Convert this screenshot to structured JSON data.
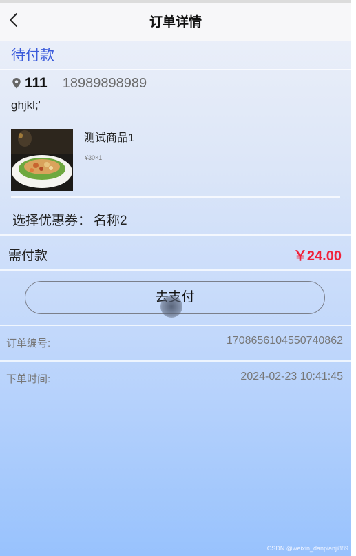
{
  "header": {
    "title": "订单详情",
    "back_icon": "chevron-left-icon"
  },
  "order": {
    "status": "待付款"
  },
  "address": {
    "name": "111",
    "phone": "18989898989",
    "detail": "ghjkl;'",
    "icon": "location-pin-icon"
  },
  "goods": {
    "name": "测试商品1",
    "price_qty": "¥30×1",
    "image": "food-plate-photo"
  },
  "coupon": {
    "label": "选择优惠券：",
    "value": "名称2"
  },
  "payment": {
    "label": "需付款",
    "amount": "￥24.00",
    "button_label": "去支付"
  },
  "info": {
    "order_no_label": "订单编号:",
    "order_no": "1708656104550740862",
    "time_label": "下单时间:",
    "time": "2024-02-23 10:41:45"
  },
  "watermark": "CSDN @weixin_danpianji889",
  "colors": {
    "status": "#3b5bdb",
    "amount": "#f0213a"
  }
}
